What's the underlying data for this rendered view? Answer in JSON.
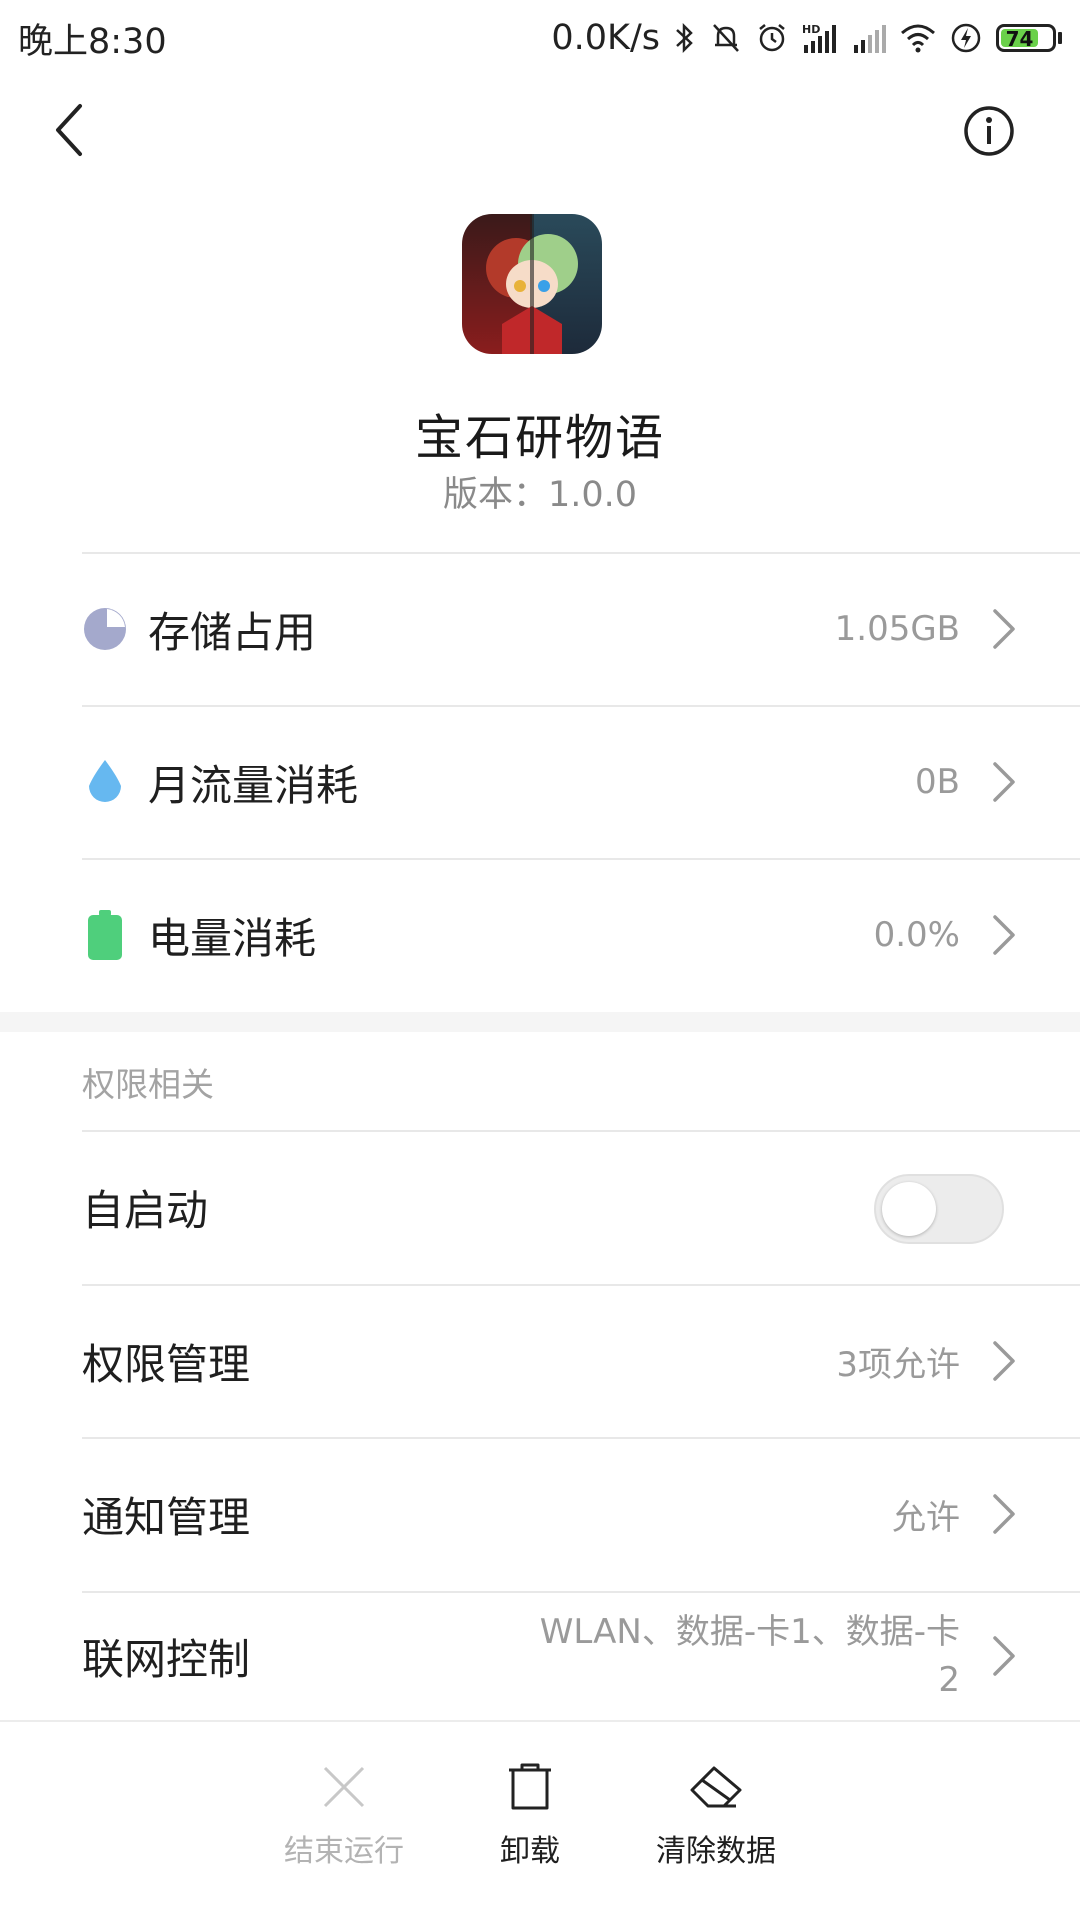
{
  "status_bar": {
    "time": "晚上8:30",
    "net_speed": "0.0K/s",
    "battery_level": "74",
    "icons": [
      "bluetooth-icon",
      "mute-icon",
      "alarm-icon",
      "hd-signal-icon",
      "signal-icon",
      "wifi-icon",
      "charging-icon",
      "battery-icon"
    ]
  },
  "nav": {
    "back_icon": "chevron-left-icon",
    "info_icon": "info-circle-icon"
  },
  "app": {
    "name": "宝石研物语",
    "version": "版本：1.0.0"
  },
  "usage": [
    {
      "label": "存储占用",
      "value": "1.05GB",
      "icon": "pie-chart-icon",
      "color": "#a4a9cc"
    },
    {
      "label": "月流量消耗",
      "value": "0B",
      "icon": "water-drop-icon",
      "color": "#66b8f0"
    },
    {
      "label": "电量消耗",
      "value": "0.0%",
      "icon": "battery-icon",
      "color": "#4fcf7c"
    }
  ],
  "permissions": {
    "section_title": "权限相关",
    "autostart": {
      "label": "自启动",
      "enabled": false
    },
    "permission_manage": {
      "label": "权限管理",
      "value": "3项允许"
    },
    "notification_manage": {
      "label": "通知管理",
      "value": "允许"
    },
    "network_control": {
      "label": "联网控制",
      "value_line1": "WLAN、数据-卡1、数据-卡",
      "value_line2": "2"
    }
  },
  "actions": [
    {
      "label": "结束运行",
      "icon": "close-x-icon",
      "enabled": false
    },
    {
      "label": "卸载",
      "icon": "trash-icon",
      "enabled": true
    },
    {
      "label": "清除数据",
      "icon": "eraser-icon",
      "enabled": true
    }
  ]
}
